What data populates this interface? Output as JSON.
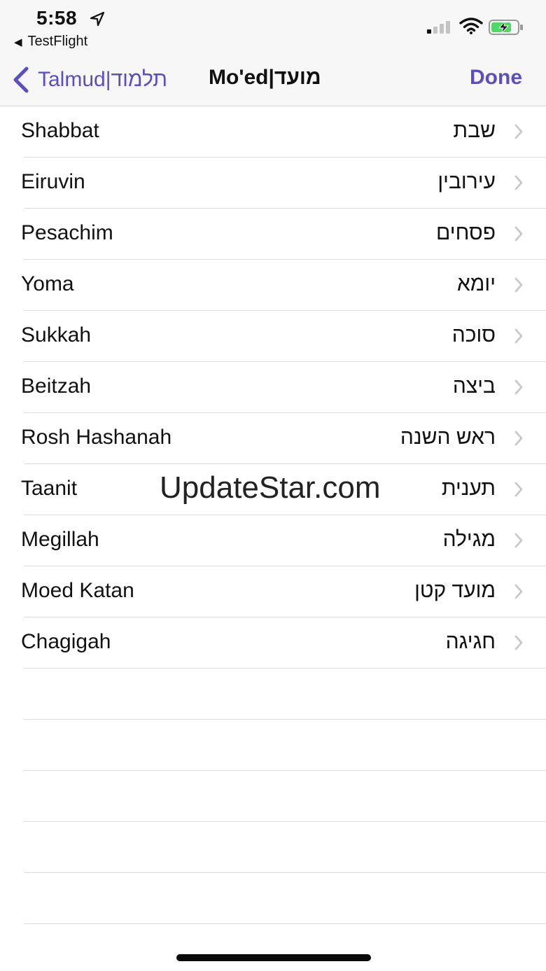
{
  "status_bar": {
    "time": "5:58",
    "back_app": "TestFlight",
    "icons": [
      "location-arrow-icon",
      "signal-icon",
      "wifi-icon",
      "battery-charging-icon"
    ]
  },
  "nav": {
    "back_label": "Talmud|תלמוד",
    "title": "Mo'ed|מועד",
    "done_label": "Done",
    "accent_color": "#5a4fc2"
  },
  "tractates": [
    {
      "english": "Shabbat",
      "hebrew": "שבת"
    },
    {
      "english": "Eiruvin",
      "hebrew": "עירובין"
    },
    {
      "english": "Pesachim",
      "hebrew": "פסחים"
    },
    {
      "english": "Yoma",
      "hebrew": "יומא"
    },
    {
      "english": "Sukkah",
      "hebrew": "סוכה"
    },
    {
      "english": "Beitzah",
      "hebrew": "ביצה"
    },
    {
      "english": "Rosh Hashanah",
      "hebrew": "ראש השנה"
    },
    {
      "english": "Taanit",
      "hebrew": "תענית"
    },
    {
      "english": "Megillah",
      "hebrew": "מגילה"
    },
    {
      "english": "Moed Katan",
      "hebrew": "מועד קטן"
    },
    {
      "english": "Chagigah",
      "hebrew": "חגיגה"
    }
  ],
  "watermark": "UpdateStar.com"
}
